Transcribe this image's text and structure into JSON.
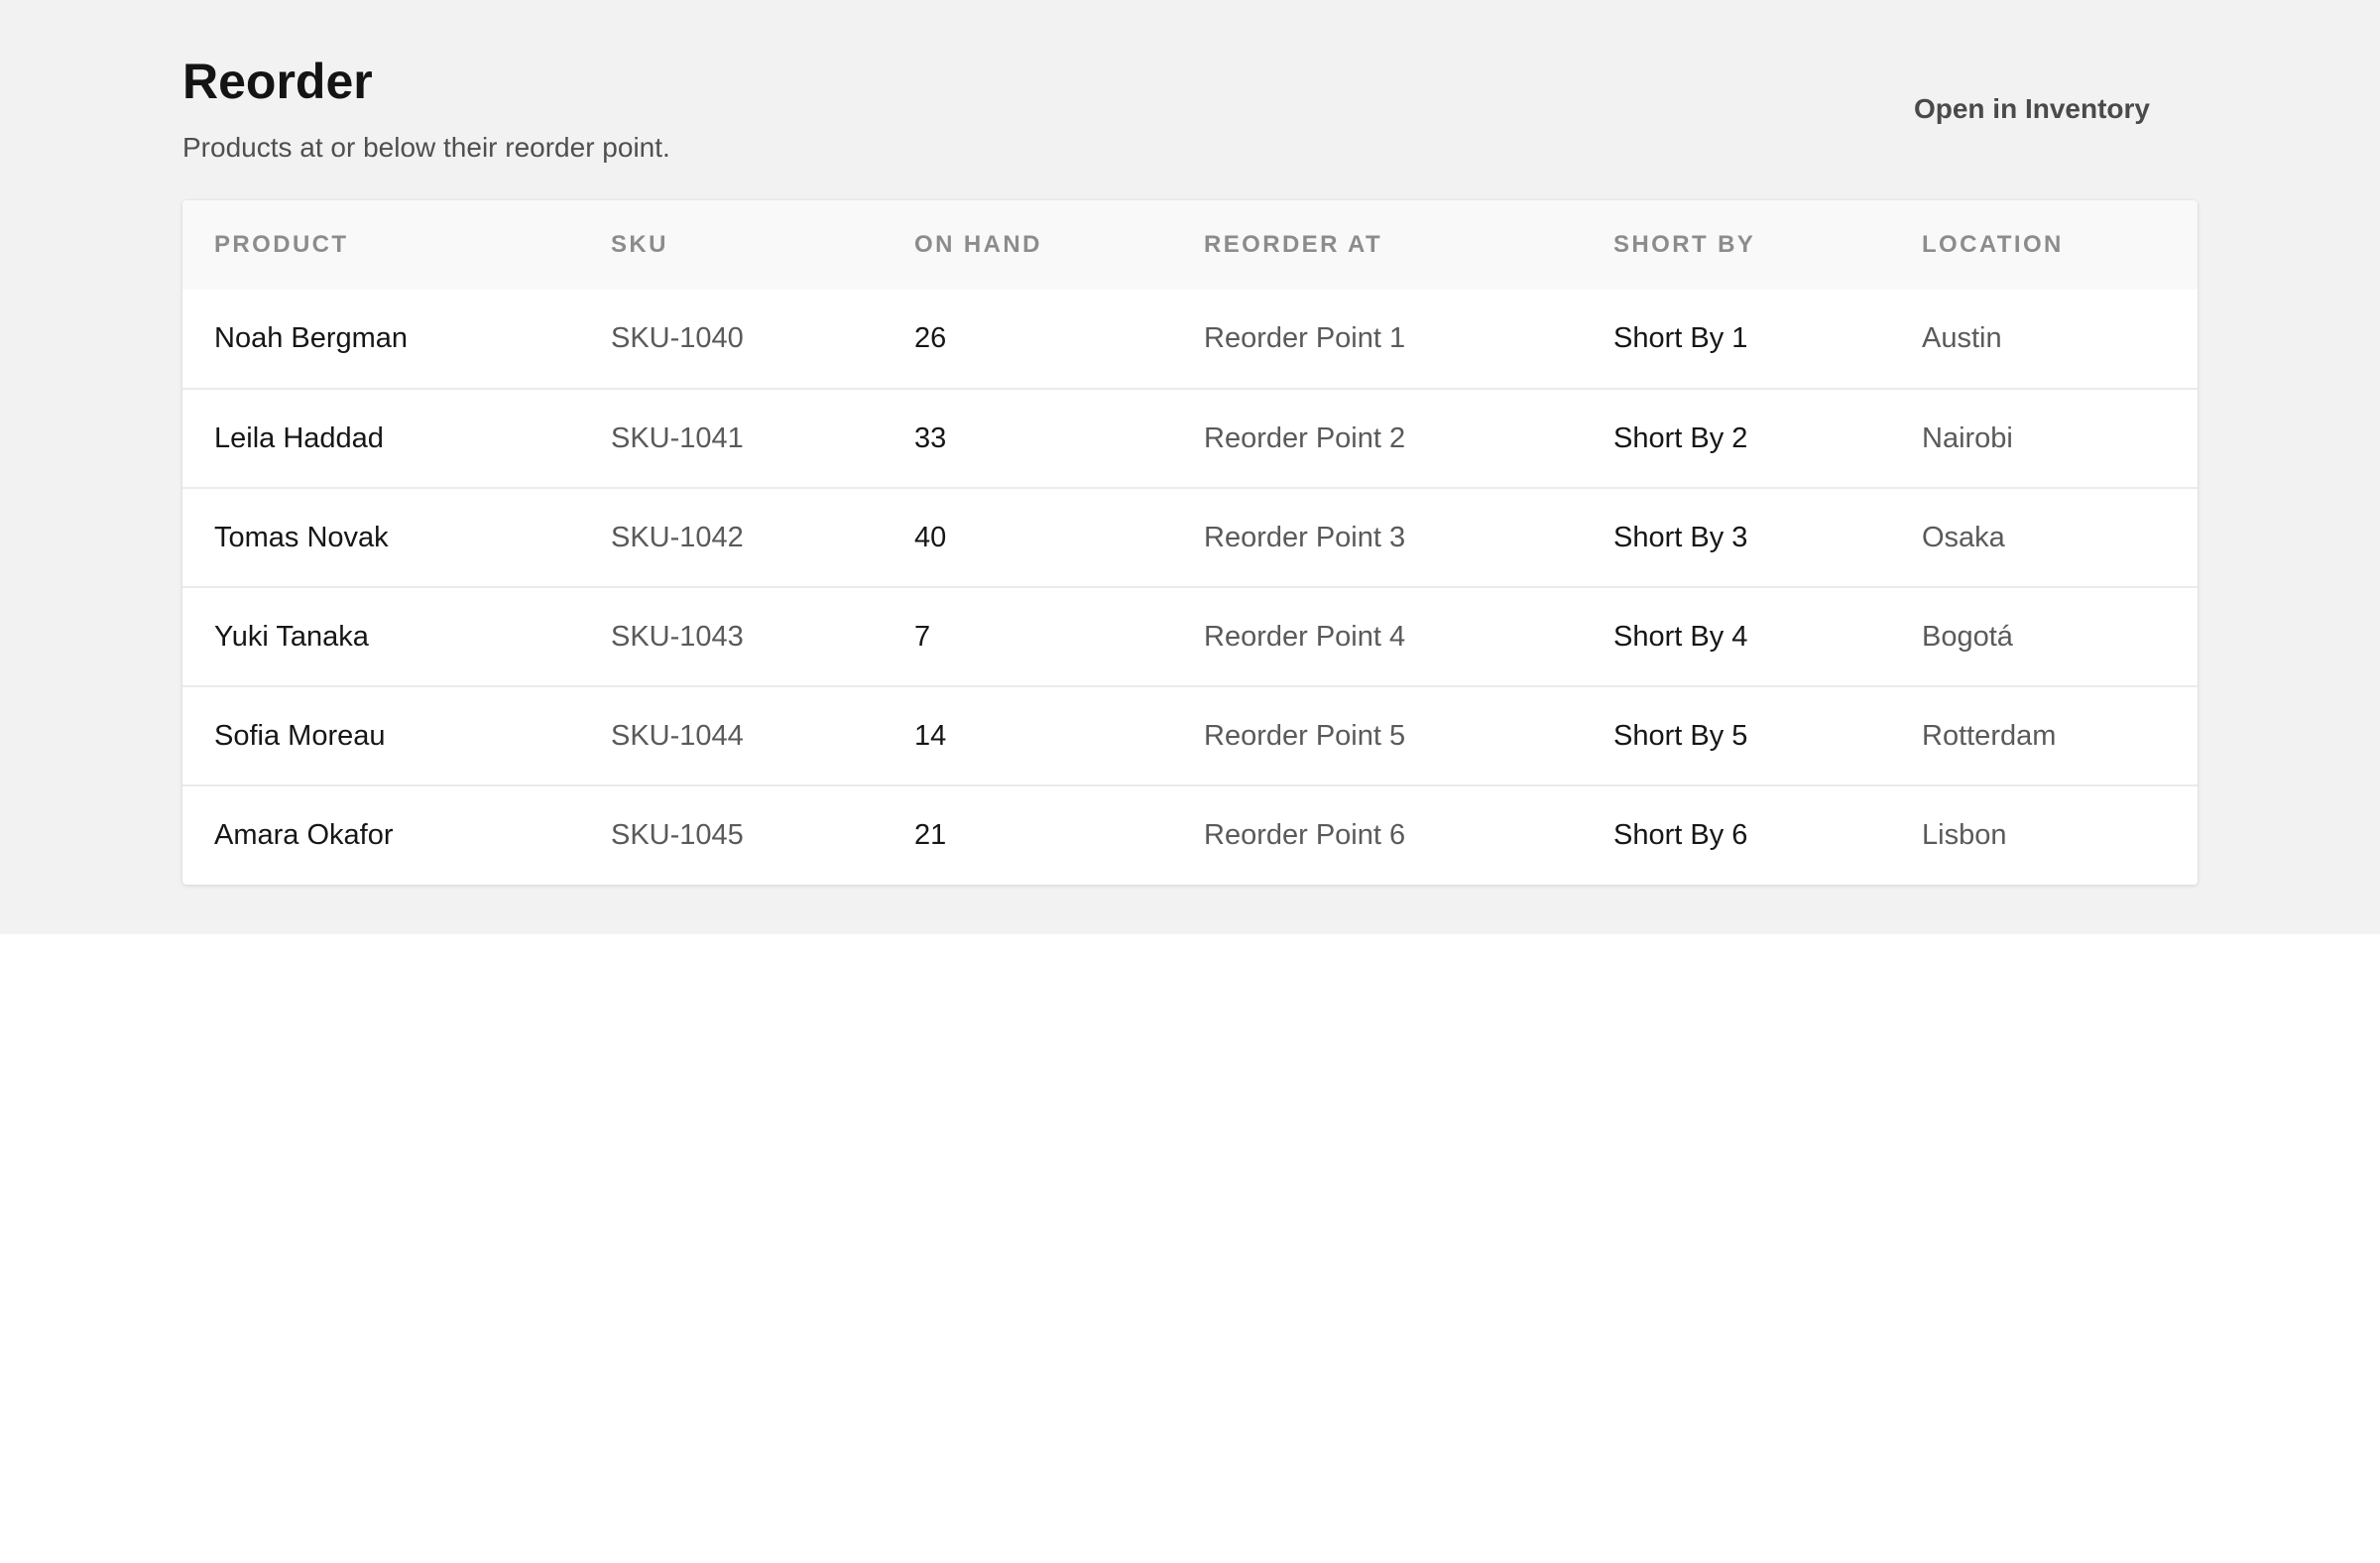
{
  "header": {
    "title": "Reorder",
    "subtitle": "Products at or below their reorder point.",
    "open_link_label": "Open in Inventory"
  },
  "table": {
    "columns": [
      "PRODUCT",
      "SKU",
      "ON HAND",
      "REORDER AT",
      "SHORT BY",
      "LOCATION"
    ],
    "rows": [
      {
        "product": "Noah Bergman",
        "sku": "SKU-1040",
        "on_hand": "26",
        "reorder_at": "Reorder Point 1",
        "short_by": "Short By 1",
        "location": "Austin"
      },
      {
        "product": "Leila Haddad",
        "sku": "SKU-1041",
        "on_hand": "33",
        "reorder_at": "Reorder Point 2",
        "short_by": "Short By 2",
        "location": "Nairobi"
      },
      {
        "product": "Tomas Novak",
        "sku": "SKU-1042",
        "on_hand": "40",
        "reorder_at": "Reorder Point 3",
        "short_by": "Short By 3",
        "location": "Osaka"
      },
      {
        "product": "Yuki Tanaka",
        "sku": "SKU-1043",
        "on_hand": "7",
        "reorder_at": "Reorder Point 4",
        "short_by": "Short By 4",
        "location": "Bogotá"
      },
      {
        "product": "Sofia Moreau",
        "sku": "SKU-1044",
        "on_hand": "14",
        "reorder_at": "Reorder Point 5",
        "short_by": "Short By 5",
        "location": "Rotterdam"
      },
      {
        "product": "Amara Okafor",
        "sku": "SKU-1045",
        "on_hand": "21",
        "reorder_at": "Reorder Point 6",
        "short_by": "Short By 6",
        "location": "Lisbon"
      }
    ]
  },
  "colors": {
    "panel_background": "#f2f2f2",
    "card_background": "#ffffff",
    "header_row_background": "#f9f9f9",
    "primary_text": "#161616",
    "secondary_text": "#5a5a5a",
    "column_header_text": "#8c8c8c"
  }
}
